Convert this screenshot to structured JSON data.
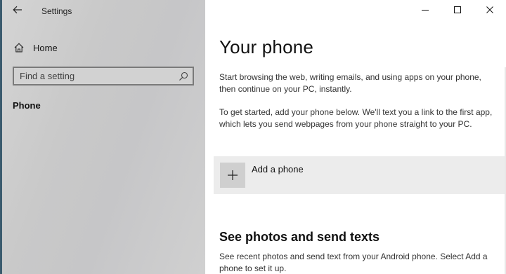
{
  "window": {
    "title": "Settings",
    "controls": {
      "minimize": "minimize-icon",
      "maximize": "maximize-icon",
      "close": "close-icon"
    }
  },
  "sidebar": {
    "home_label": "Home",
    "search": {
      "placeholder": "Find a setting",
      "value": ""
    },
    "section_label": "Phone"
  },
  "main": {
    "title": "Your phone",
    "intro": "Start browsing the web, writing emails, and using apps on your phone, then continue on your PC, instantly.",
    "get_started": "To get started, add your phone below. We'll text you a link to the first app, which lets you send webpages from your phone straight to your PC.",
    "add_phone_label": "Add a phone",
    "photos_title": "See photos and send texts",
    "photos_desc": "See recent photos and send text from your Android phone. Select Add a phone to set it up."
  },
  "colors": {
    "sidebar_bg": "#c9c9c9",
    "card_bg": "#ececec",
    "plus_bg": "#cfcfcf"
  }
}
